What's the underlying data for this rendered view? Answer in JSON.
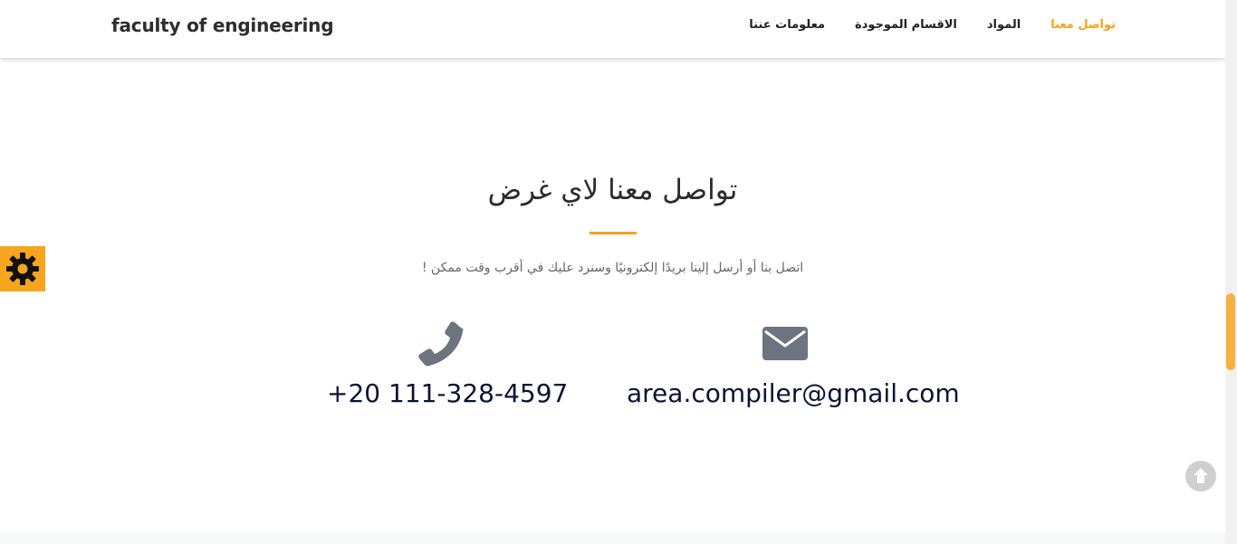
{
  "header": {
    "brand": "faculty of engineering",
    "nav": [
      {
        "label": "تواصل معنا",
        "active": true
      },
      {
        "label": "المواد",
        "active": false
      },
      {
        "label": "الاقسام الموجودة",
        "active": false
      },
      {
        "label": "معلومات عننا",
        "active": false
      }
    ]
  },
  "contact": {
    "title": "تواصل معنا لاي غرض",
    "subtitle": "اتصل بنا أو أرسل إلينا بريدًا إلكترونيًا وسنرد عليك في أقرب وقت ممكن !",
    "phone": "+20 111-328-4597",
    "email": "area.compiler@gmail.com"
  },
  "icons": {
    "settings": "gear-icon",
    "phone": "phone-icon",
    "email": "envelope-icon",
    "scroll_top": "arrow-up-circle-icon"
  },
  "colors": {
    "accent": "#f6a21d",
    "text_dark": "#0b1332",
    "icon_gray": "#6c7480"
  }
}
